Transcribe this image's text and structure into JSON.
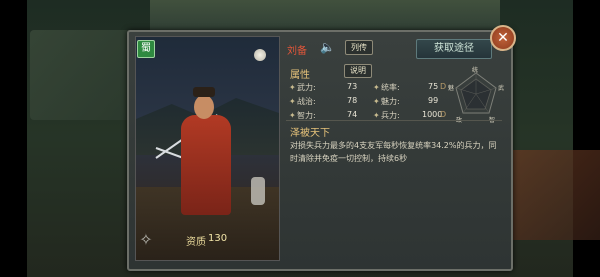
{
  "hero": {
    "name": "刘备",
    "bio_label": "列传",
    "source_label": "获取途径",
    "faction_glyph": "蜀",
    "quality_label": "资质",
    "quality_value": "130"
  },
  "attributes": {
    "title": "属性",
    "explain_label": "说明",
    "stats": [
      {
        "label": "武力:",
        "value": "73"
      },
      {
        "label": "统率:",
        "value": "75"
      },
      {
        "label": "战治:",
        "value": "78"
      },
      {
        "label": "魅力:",
        "value": "99"
      },
      {
        "label": "智力:",
        "value": "74"
      },
      {
        "label": "兵力:",
        "value": "1000"
      }
    ],
    "stat_grades": [
      "D",
      "D"
    ],
    "radar_labels": [
      "统",
      "武",
      "智",
      "政",
      "魅"
    ]
  },
  "skill": {
    "name": "泽被天下",
    "description": "对损失兵力最多的4支友军每秒恢复统率34.2%的兵力，同时清除并免疫一切控制，持续6秒"
  },
  "icons": [
    "sound-icon",
    "compass-icon",
    "close-icon",
    "faction-badge-icon"
  ]
}
